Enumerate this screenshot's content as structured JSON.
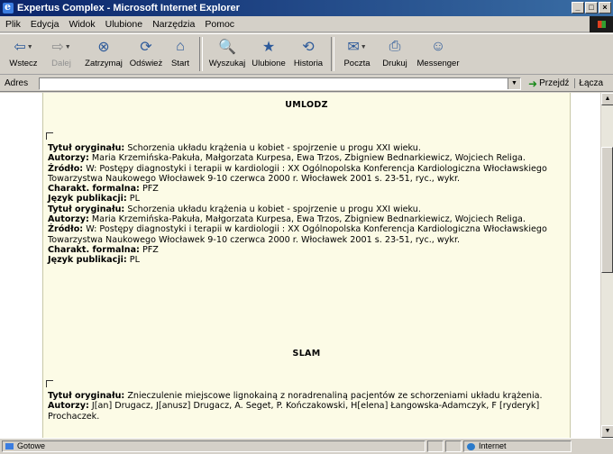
{
  "window": {
    "title": "Expertus Complex - Microsoft Internet Explorer"
  },
  "menu": [
    "Plik",
    "Edycja",
    "Widok",
    "Ulubione",
    "Narzędzia",
    "Pomoc"
  ],
  "toolbar": [
    {
      "label": "Wstecz",
      "icon": "back-arrow-icon",
      "glyph": "⇦",
      "dropdown": true,
      "disabled": false
    },
    {
      "label": "Dalej",
      "icon": "forward-arrow-icon",
      "glyph": "⇨",
      "dropdown": true,
      "disabled": true
    },
    {
      "label": "Zatrzymaj",
      "icon": "stop-icon",
      "glyph": "⊗",
      "dropdown": false,
      "disabled": false
    },
    {
      "label": "Odśwież",
      "icon": "refresh-icon",
      "glyph": "⟳",
      "dropdown": false,
      "disabled": false
    },
    {
      "label": "Start",
      "icon": "home-icon",
      "glyph": "⌂",
      "dropdown": false,
      "disabled": false
    },
    {
      "label": "Wyszukaj",
      "icon": "search-icon",
      "glyph": "🔍",
      "dropdown": false,
      "disabled": false
    },
    {
      "label": "Ulubione",
      "icon": "favorites-icon",
      "glyph": "★",
      "dropdown": false,
      "disabled": false
    },
    {
      "label": "Historia",
      "icon": "history-icon",
      "glyph": "⟲",
      "dropdown": false,
      "disabled": false
    },
    {
      "label": "Poczta",
      "icon": "mail-icon",
      "glyph": "✉",
      "dropdown": true,
      "disabled": false
    },
    {
      "label": "Drukuj",
      "icon": "print-icon",
      "glyph": "⎙",
      "dropdown": false,
      "disabled": false
    },
    {
      "label": "Messenger",
      "icon": "messenger-icon",
      "glyph": "☺",
      "dropdown": false,
      "disabled": false
    }
  ],
  "address": {
    "label": "Adres",
    "value": "",
    "go": "Przejdź",
    "links": "Łącza"
  },
  "sections": [
    {
      "heading": "UMLODZ",
      "records": [
        {
          "fields": [
            {
              "label": "Tytuł oryginału:",
              "value": "Schorzenia układu krążenia u kobiet - spojrzenie u progu XXI wieku."
            },
            {
              "label": "Autorzy:",
              "value": "Maria Krzemińska-Pakuła, Małgorzata Kurpesa, Ewa Trzos, Zbigniew Bednarkiewicz, Wojciech Religa."
            },
            {
              "label": "Źródło:",
              "value": "W: Postępy diagnostyki i terapii w kardiologii : XX Ogólnopolska Konferencja Kardiologiczna Włocławskiego Towarzystwa Naukowego Włocławek 9-10 czerwca 2000 r. Włocławek 2001 s. 23-51, ryc., wykr."
            },
            {
              "label": "Charakt. formalna:",
              "value": "PFZ"
            },
            {
              "label": "Język publikacji:",
              "value": "PL"
            },
            {
              "label": "Tytuł oryginału:",
              "value": "Schorzenia układu krążenia u kobiet - spojrzenie u progu XXI wieku."
            },
            {
              "label": "Autorzy:",
              "value": "Maria Krzemińska-Pakuła, Małgorzata Kurpesa, Ewa Trzos, Zbigniew Bednarkiewicz, Wojciech Religa."
            },
            {
              "label": "Źródło:",
              "value": "W: Postępy diagnostyki i terapii w kardiologii : XX Ogólnopolska Konferencja Kardiologiczna Włocławskiego Towarzystwa Naukowego Włocławek 9-10 czerwca 2000 r. Włocławek 2001 s. 23-51, ryc., wykr."
            },
            {
              "label": "Charakt. formalna:",
              "value": "PFZ"
            },
            {
              "label": "Język publikacji:",
              "value": "PL"
            }
          ]
        }
      ]
    },
    {
      "heading": "SLAM",
      "records": [
        {
          "fields": [
            {
              "label": "Tytuł oryginału:",
              "value": "Znieczulenie miejscowe lignokainą z noradrenaliną pacjentów ze schorzeniami układu krążenia."
            },
            {
              "label": "Autorzy:",
              "value": "J[an] Drugacz, J[anusz] Drugacz, A. Seget, P. Kończakowski, H[elena] Łangowska-Adamczyk, F [ryderyk] Prochaczek."
            }
          ]
        }
      ]
    }
  ],
  "status": {
    "text": "Gotowe",
    "zone": "Internet"
  }
}
